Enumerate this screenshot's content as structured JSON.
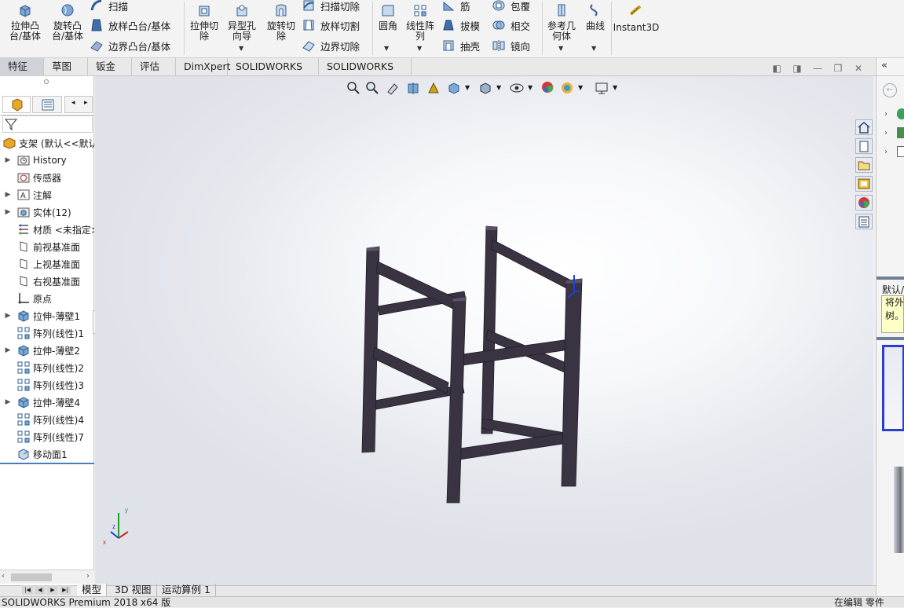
{
  "ribbon": {
    "extrude_boss": "拉伸凸\n台/基体",
    "revolve_boss": "旋转凸\n台/基体",
    "sweep": "扫描",
    "loft_boss": "放样凸台/基体",
    "boundary_boss": "边界凸台/基体",
    "extrude_cut": "拉伸切\n除",
    "hole_wizard": "异型孔\n向导",
    "revolve_cut": "旋转切\n除",
    "swept_cut": "扫描切除",
    "lofted_cut": "放样切割",
    "boundary_cut": "边界切除",
    "fillet": "圆角",
    "linear_pattern": "线性阵\n列",
    "rib": "筋",
    "draft": "拔模",
    "shell": "抽壳",
    "wrap": "包覆",
    "intersect": "相交",
    "mirror": "镜向",
    "ref_geometry": "参考几\n何体",
    "curves": "曲线",
    "instant3d": "Instant3D"
  },
  "tabs": [
    "特征",
    "草图",
    "钣金",
    "评估",
    "DimXpert",
    "SOLIDWORKS 插件",
    "SOLIDWORKS MBD"
  ],
  "active_tab": "特征",
  "tree": {
    "root": "支架 (默认<<默认>",
    "items": [
      {
        "label": "History",
        "icon": "history-folder-icon",
        "expandable": true
      },
      {
        "label": "传感器",
        "icon": "sensor-icon",
        "expandable": false
      },
      {
        "label": "注解",
        "icon": "annotation-icon",
        "expandable": true
      },
      {
        "label": "实体(12)",
        "icon": "solid-bodies-icon",
        "expandable": true
      },
      {
        "label": "材质 <未指定>",
        "icon": "material-icon",
        "expandable": false
      },
      {
        "label": "前视基准面",
        "icon": "plane-icon",
        "expandable": false
      },
      {
        "label": "上视基准面",
        "icon": "plane-icon",
        "expandable": false
      },
      {
        "label": "右视基准面",
        "icon": "plane-icon",
        "expandable": false
      },
      {
        "label": "原点",
        "icon": "origin-icon",
        "expandable": false
      },
      {
        "label": "拉伸-薄壁1",
        "icon": "extrude-feature-icon",
        "expandable": true
      },
      {
        "label": "阵列(线性)1",
        "icon": "linear-pattern-icon",
        "expandable": false
      },
      {
        "label": "拉伸-薄壁2",
        "icon": "extrude-feature-icon",
        "expandable": true
      },
      {
        "label": "阵列(线性)2",
        "icon": "linear-pattern-icon",
        "expandable": false
      },
      {
        "label": "阵列(线性)3",
        "icon": "linear-pattern-icon",
        "expandable": false
      },
      {
        "label": "拉伸-薄壁4",
        "icon": "extrude-feature-icon",
        "expandable": true
      },
      {
        "label": "阵列(线性)4",
        "icon": "linear-pattern-icon",
        "expandable": false
      },
      {
        "label": "阵列(线性)7",
        "icon": "linear-pattern-icon",
        "expandable": false
      },
      {
        "label": "移动面1",
        "icon": "move-face-icon",
        "expandable": false
      }
    ]
  },
  "bottom_tabs": [
    "模型",
    "3D 视图",
    "运动算例 1"
  ],
  "active_bottom_tab": "模型",
  "status": {
    "left": "SOLIDWORKS Premium 2018 x64 版",
    "right": "在编辑 零件"
  },
  "taskpane": {
    "title": "默认/",
    "tooltip": "将外\n树。"
  },
  "colors": {
    "frame": "#3a3342",
    "ribbon_bg": "#f3f3f3",
    "active_tab": "#cfd3d8",
    "tooltip_bg": "#ffffc8"
  }
}
